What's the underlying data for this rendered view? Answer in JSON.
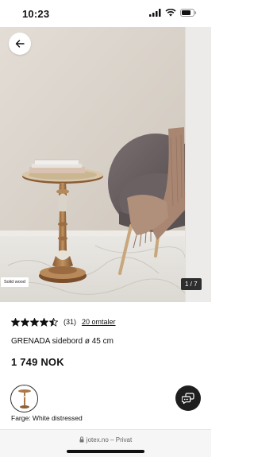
{
  "status_bar": {
    "time": "10:23"
  },
  "gallery": {
    "badge": "Solid wood",
    "counter": "1 / 7"
  },
  "product": {
    "rating_value": 4.5,
    "rating_count": "(31)",
    "reviews_link": "20 omtaler",
    "title": "GRENADA sidebord ø 45 cm",
    "price": "1 749 NOK",
    "color_label": "Farge: White distressed"
  },
  "browser": {
    "domain": "jotex.no",
    "separator": " – ",
    "mode": "Privat"
  },
  "colors": {
    "wall": "#d9d3cb",
    "chair": "#5e5557",
    "wood": "#a9794b",
    "chat_button": "#1e1e1e"
  },
  "icons": [
    "cellular-signal-icon",
    "wifi-icon",
    "battery-icon",
    "back-arrow-icon",
    "star-icon",
    "chat-icon",
    "lock-icon"
  ]
}
